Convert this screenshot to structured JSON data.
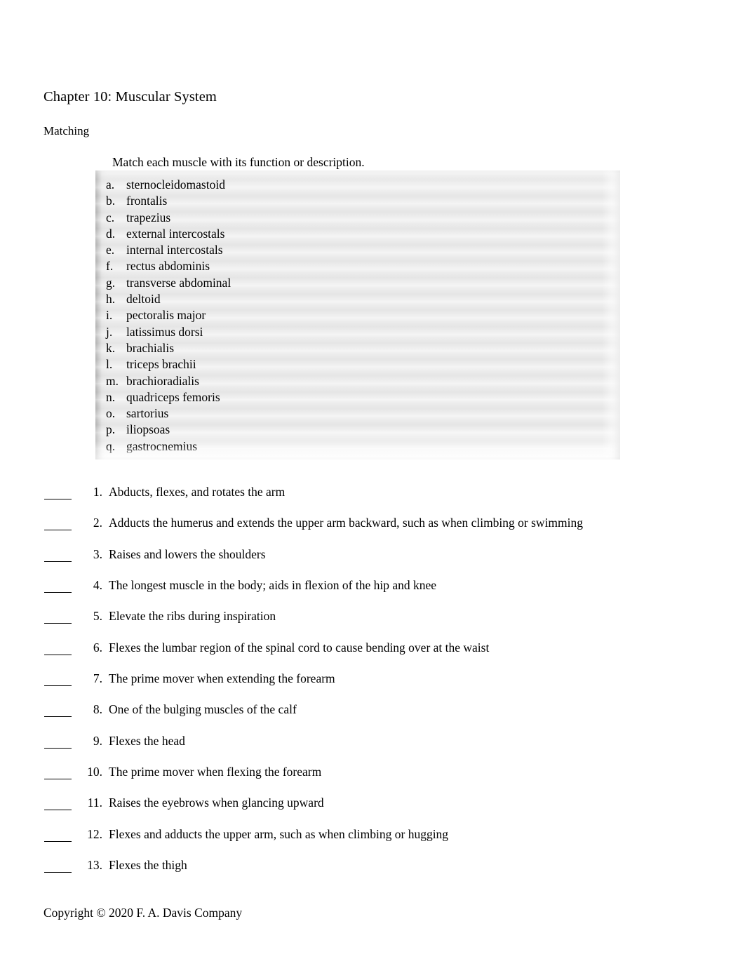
{
  "document": {
    "title": "Chapter 10: Muscular System",
    "section_label": "Matching",
    "instruction": "Match each muscle with its function or description.",
    "footer": "Copyright © 2020 F. A. Davis Company"
  },
  "colors": {
    "page_background": "#ffffff",
    "text": "#000000",
    "option_box_background": "#eaeaea",
    "option_box_edge_shadow": "#969696",
    "rule_line": "#000000"
  },
  "option_box": {
    "items": [
      {
        "marker": "a.",
        "label": "sternocleidomastoid"
      },
      {
        "marker": "b.",
        "label": "frontalis"
      },
      {
        "marker": "c.",
        "label": "trapezius"
      },
      {
        "marker": "d.",
        "label": "external intercostals"
      },
      {
        "marker": "e.",
        "label": "internal intercostals"
      },
      {
        "marker": "f.",
        "label": "rectus abdominis"
      },
      {
        "marker": "g.",
        "label": "transverse abdominal"
      },
      {
        "marker": "h.",
        "label": "deltoid"
      },
      {
        "marker": "i.",
        "label": "pectoralis major"
      },
      {
        "marker": "j.",
        "label": "latissimus dorsi"
      },
      {
        "marker": "k.",
        "label": "brachialis"
      },
      {
        "marker": "l.",
        "label": "triceps brachii"
      },
      {
        "marker": "m.",
        "label": "brachioradialis"
      },
      {
        "marker": "n.",
        "label": "quadriceps femoris"
      },
      {
        "marker": "o.",
        "label": "sartorius"
      },
      {
        "marker": "p.",
        "label": "iliopsoas"
      },
      {
        "marker": "q.",
        "label": "gastrocnemius"
      }
    ]
  },
  "questions": {
    "items": [
      {
        "number": "1.",
        "text": "Abducts, flexes, and rotates the arm",
        "answer": ""
      },
      {
        "number": "2.",
        "text": "Adducts the humerus and extends the upper arm backward, such as when climbing or swimming",
        "answer": ""
      },
      {
        "number": "3.",
        "text": "Raises and lowers the shoulders",
        "answer": ""
      },
      {
        "number": "4.",
        "text": "The longest muscle in the body; aids in flexion of the hip and knee",
        "answer": ""
      },
      {
        "number": "5.",
        "text": "Elevate the ribs during inspiration",
        "answer": ""
      },
      {
        "number": "6.",
        "text": "Flexes the lumbar region of the spinal cord to cause bending over at the waist",
        "answer": ""
      },
      {
        "number": "7.",
        "text": "The prime mover when extending the forearm",
        "answer": ""
      },
      {
        "number": "8.",
        "text": "One of the bulging muscles of the calf",
        "answer": ""
      },
      {
        "number": "9.",
        "text": "Flexes the head",
        "answer": ""
      },
      {
        "number": "10.",
        "text": "The prime mover when flexing the forearm",
        "answer": ""
      },
      {
        "number": "11.",
        "text": "Raises the eyebrows when glancing upward",
        "answer": ""
      },
      {
        "number": "12.",
        "text": "Flexes and adducts the upper arm, such as when climbing or hugging",
        "answer": ""
      },
      {
        "number": "13.",
        "text": "Flexes the thigh",
        "answer": ""
      }
    ]
  }
}
